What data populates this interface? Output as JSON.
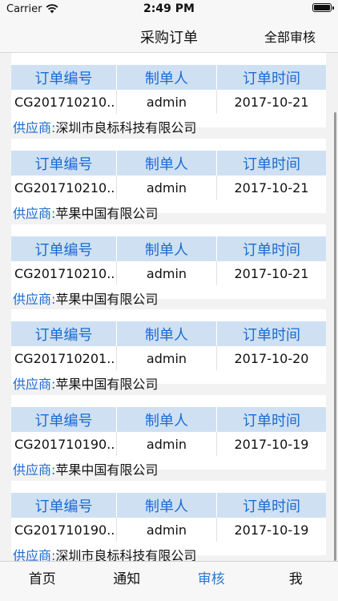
{
  "status_bar": {
    "carrier": "Carrier",
    "time": "2:49 PM"
  },
  "nav": {
    "title": "采购订单",
    "action": "全部审核"
  },
  "headers": {
    "order_no": "订单编号",
    "creator": "制单人",
    "order_time": "订单时间"
  },
  "supplier_label": "供应商:",
  "orders": [
    {
      "order_no": "CG201710210...",
      "creator": "admin",
      "time": "2017-10-21",
      "supplier": "深圳市良标科技有限公司"
    },
    {
      "order_no": "CG201710210...",
      "creator": "admin",
      "time": "2017-10-21",
      "supplier": "苹果中国有限公司"
    },
    {
      "order_no": "CG201710210...",
      "creator": "admin",
      "time": "2017-10-21",
      "supplier": "苹果中国有限公司"
    },
    {
      "order_no": "CG201710201...",
      "creator": "admin",
      "time": "2017-10-20",
      "supplier": "苹果中国有限公司"
    },
    {
      "order_no": "CG201710190...",
      "creator": "admin",
      "time": "2017-10-19",
      "supplier": "苹果中国有限公司"
    },
    {
      "order_no": "CG201710190...",
      "creator": "admin",
      "time": "2017-10-19",
      "supplier": "深圳市良标科技有限公司"
    }
  ],
  "tabs": [
    {
      "label": "首页",
      "active": false
    },
    {
      "label": "通知",
      "active": false
    },
    {
      "label": "审核",
      "active": true
    },
    {
      "label": "我",
      "active": false
    }
  ],
  "colors": {
    "accent": "#1a6bd1",
    "header_bg": "#cfe0f3",
    "tab_active": "#2a76d2"
  }
}
